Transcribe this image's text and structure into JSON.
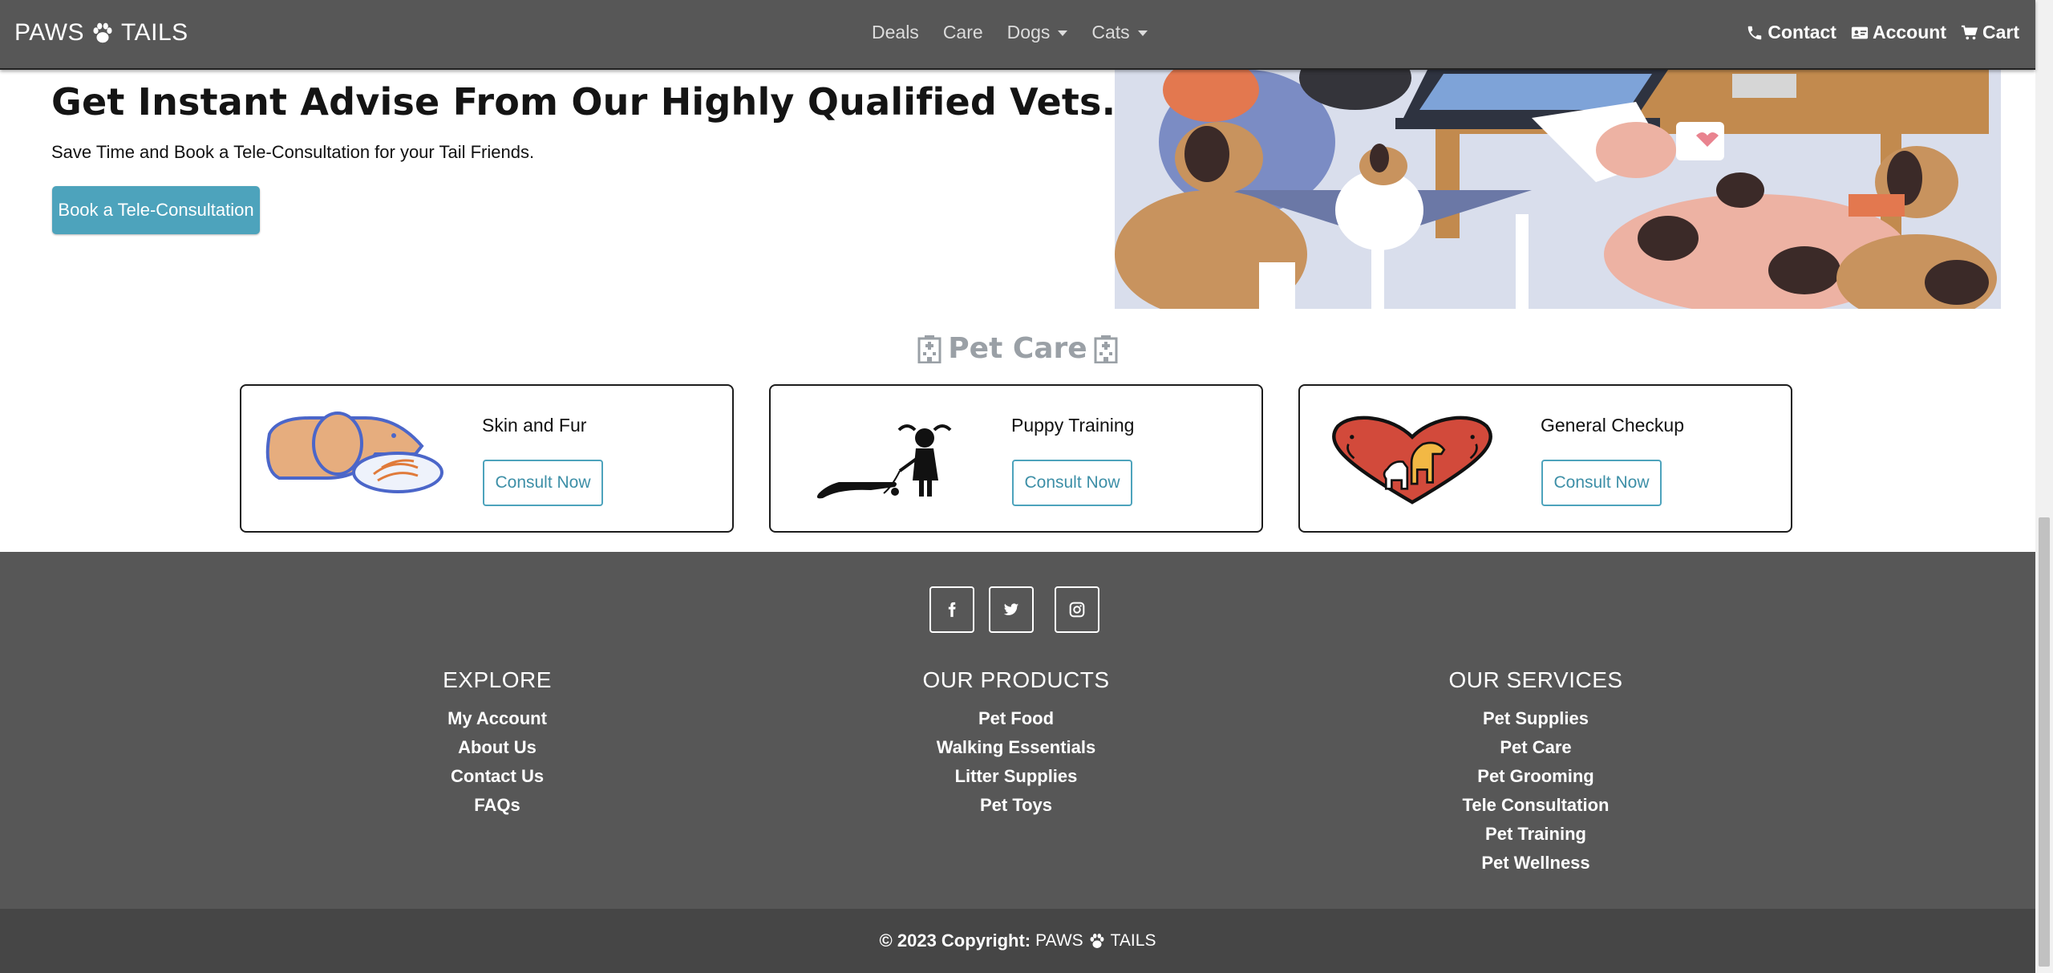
{
  "navbar": {
    "brand_left": "PAWS",
    "brand_right": "TAILS",
    "links": [
      {
        "label": "Deals",
        "dropdown": false
      },
      {
        "label": "Care",
        "dropdown": false
      },
      {
        "label": "Dogs",
        "dropdown": true
      },
      {
        "label": "Cats",
        "dropdown": true
      }
    ],
    "right_links": [
      {
        "label": "Contact",
        "icon": "phone-icon"
      },
      {
        "label": "Account",
        "icon": "id-card-icon"
      },
      {
        "label": "Cart",
        "icon": "cart-icon"
      }
    ]
  },
  "hero": {
    "title": "Get Instant Advise From Our Highly Qualified Vets.",
    "subtitle": "Save Time and Book a Tele-Consultation for your Tail Friends.",
    "button": "Book a Tele-Consultation"
  },
  "pet_care": {
    "title": "Pet Care",
    "cards": [
      {
        "title": "Skin and Fur",
        "button": "Consult Now",
        "icon": "dog-grooming-image"
      },
      {
        "title": "Puppy Training",
        "button": "Consult Now",
        "icon": "dog-training-image"
      },
      {
        "title": "General Checkup",
        "button": "Consult Now",
        "icon": "heart-pets-image"
      }
    ]
  },
  "footer": {
    "social": [
      "facebook-icon",
      "twitter-icon",
      "instagram-icon"
    ],
    "explore": {
      "heading": "EXPLORE",
      "links": [
        "My Account",
        "About Us",
        "Contact Us",
        "FAQs"
      ]
    },
    "products": {
      "heading": "OUR PRODUCTS",
      "links": [
        "Pet Food",
        "Walking Essentials",
        "Litter Supplies",
        "Pet Toys"
      ]
    },
    "services": {
      "heading": "OUR SERVICES",
      "links": [
        "Pet Supplies",
        "Pet Care",
        "Pet Grooming",
        "Tele Consultation",
        "Pet Training",
        "Pet Wellness"
      ]
    },
    "copyright_prefix": "© 2023 Copyright:",
    "copyright_brand_left": "PAWS",
    "copyright_brand_right": "TAILS"
  },
  "colors": {
    "navbar_bg": "#575757",
    "accent": "#4da3bc",
    "footer_bg": "#575757",
    "copyright_bg": "#464646"
  }
}
